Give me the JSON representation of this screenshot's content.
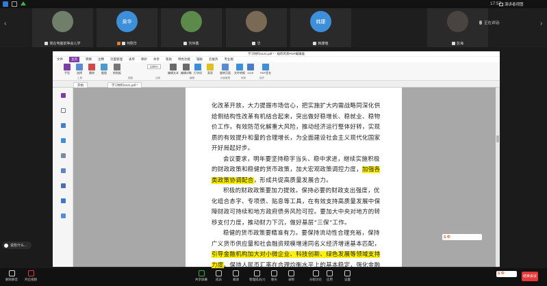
{
  "topbar": {
    "time": "17:57",
    "view_mode": "演讲者视图"
  },
  "participants": [
    {
      "name": "我在电脑前等会儿学",
      "avatar_color": "#6f7f6a",
      "avatar_text": ""
    },
    {
      "name": "何刚华",
      "avatar_color": "#3c8fd8",
      "avatar_text": "昊华",
      "host": true
    },
    {
      "name": "刘世鑫",
      "avatar_color": "#5b8a4a",
      "avatar_text": ""
    },
    {
      "name": "华",
      "avatar_color": "#7a6a55",
      "avatar_text": ""
    },
    {
      "name": "韩康雍",
      "avatar_color": "#3c8fd8",
      "avatar_text": "韩康"
    },
    {
      "name": "彭海",
      "avatar_color": "#4a4440",
      "avatar_text": ""
    }
  ],
  "speaking_label": "正在讲话:",
  "pdf": {
    "window_title": "学习材料1121.pdf * - 福昕风景PDF编辑器",
    "menu": [
      "文件",
      "主页",
      "转换",
      "注释",
      "页面管理",
      "表单",
      "保护",
      "共享",
      "帮助",
      "特色功能",
      "辅助",
      "云服务",
      "专业版"
    ],
    "selected_menu_index": 1,
    "ribbon_buttons": [
      "手型",
      "选择",
      "删除",
      "截图",
      "剪贴板",
      "编辑文本",
      "编辑对象",
      "打字机",
      "高亮",
      "旋转页面",
      "文件转换",
      "OCR",
      "PDF签名"
    ],
    "ribbon_groups": [
      "工具",
      "视图",
      "注释",
      "编辑",
      "页面管理",
      "转换",
      "保护"
    ],
    "zoom": "125%",
    "tabs": [
      "开始",
      "学习材料1121.pdf *"
    ],
    "paragraphs": [
      {
        "segments": [
          {
            "text": "化改革开放，大力提振市场信心，把实施扩大内需战略同深化供给侧结构性改革有机结合起来，突出做好稳增长、稳就业、稳物价工作，有效防范化解重大风险，推动经济运行整体好转，实现质的有效提升和量的合理增长，为全面建设社会主义现代化国家开好局起好步。"
          }
        ],
        "first": true
      },
      {
        "segments": [
          {
            "text": "会议要求，明年要坚持稳字当头、稳中求进，继续实施积极的财政政策和稳健的货币政策，加大宏观政策调控力度，"
          },
          {
            "text": "加强各类政策协调配合",
            "hl": true
          },
          {
            "text": "，形成共促高质量发展合力。"
          }
        ]
      },
      {
        "segments": [
          {
            "text": "积极的财政政策要加力提效。保持必要的财政支出强度，优化组合赤字、专项债、贴息等工具，在有效支持高质量发展中保障财政可持续和地方政府债务风险可控。要加大中央对地方的转移支付力度，推动财力下沉，做好基层“三保”工作。"
          }
        ]
      },
      {
        "segments": [
          {
            "text": "稳健的货币政策要精准有力。要保持流动性合理充裕，保持广义货币供应量和社会融资规模增速同名义经济增速基本匹配，"
          },
          {
            "text": "引导金融机构加大对小微企业、科技创新、绿色发展等领域支持力度",
            "hl": true
          },
          {
            "text": "。保持人民币汇率在合理均衡水平上的基本稳定，强化金融稳定保障体系。"
          }
        ]
      }
    ]
  },
  "chat_label": "说些什么...",
  "toolbar": {
    "items": [
      "解除静音",
      "开启视频",
      "共享屏幕",
      "成员",
      "邀请",
      "管理成员(7)",
      "聊天",
      "录制",
      "分组讨论",
      "应用",
      "设置"
    ],
    "end_label": "结束会议"
  },
  "ime_label": "S 中"
}
